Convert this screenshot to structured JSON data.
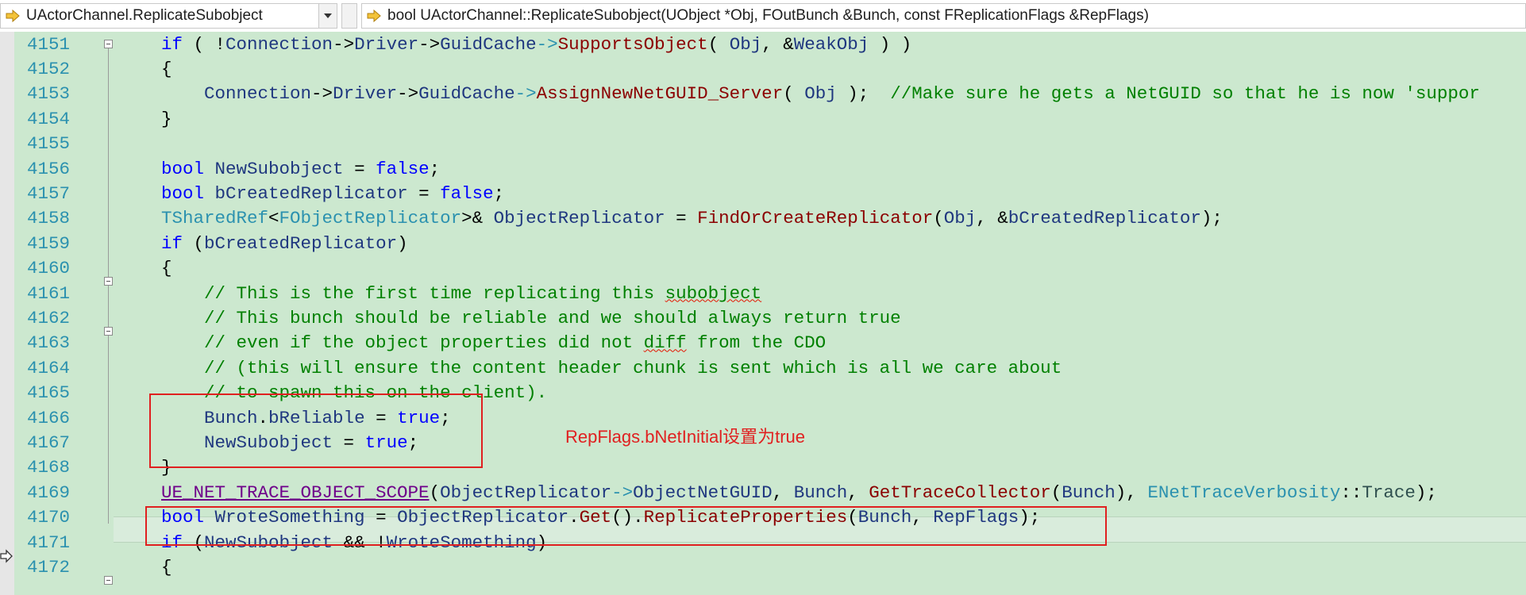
{
  "navbar": {
    "left_scope": "UActorChannel.ReplicateSubobject",
    "right_member": "bool UActorChannel::ReplicateSubobject(UObject *Obj, FOutBunch &Bunch, const FReplicationFlags &RepFlags)"
  },
  "lines": [
    {
      "n": "4151"
    },
    {
      "n": "4152"
    },
    {
      "n": "4153"
    },
    {
      "n": "4154"
    },
    {
      "n": "4155"
    },
    {
      "n": "4156"
    },
    {
      "n": "4157"
    },
    {
      "n": "4158"
    },
    {
      "n": "4159"
    },
    {
      "n": "4160"
    },
    {
      "n": "4161"
    },
    {
      "n": "4162"
    },
    {
      "n": "4163"
    },
    {
      "n": "4164"
    },
    {
      "n": "4165"
    },
    {
      "n": "4166"
    },
    {
      "n": "4167"
    },
    {
      "n": "4168"
    },
    {
      "n": "4169"
    },
    {
      "n": "4170"
    },
    {
      "n": "4171"
    },
    {
      "n": "4172"
    }
  ],
  "annotation": "RepFlags.bNetInitial设置为true",
  "colors": {
    "editor_bg": "#cce8cf",
    "annotation_red": "#e02020",
    "keyword": "#0000ff",
    "comment": "#008000",
    "type": "#2b91af"
  }
}
